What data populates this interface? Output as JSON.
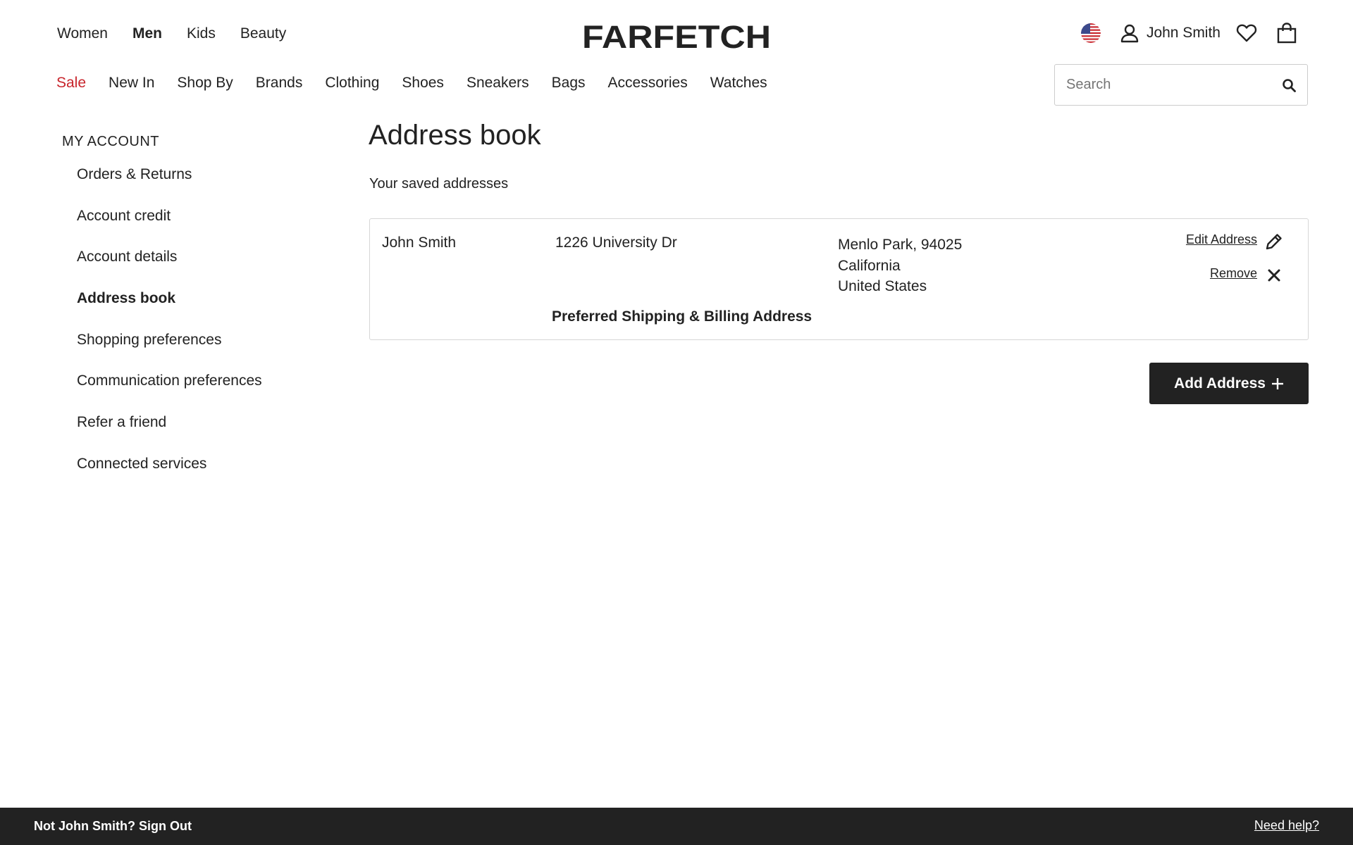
{
  "header": {
    "brand": "FARFETCH",
    "gender_tabs": [
      {
        "label": "Women",
        "active": false
      },
      {
        "label": "Men",
        "active": true
      },
      {
        "label": "Kids",
        "active": false
      },
      {
        "label": "Beauty",
        "active": false
      }
    ],
    "user_name": "John Smith",
    "icons": {
      "country_flag": "us-flag-icon",
      "user": "user-icon",
      "wishlist": "heart-icon",
      "bag": "shopping-bag-icon"
    }
  },
  "category_nav": {
    "items": [
      "Sale",
      "New In",
      "Shop By",
      "Brands",
      "Clothing",
      "Shoes",
      "Sneakers",
      "Bags",
      "Accessories",
      "Watches"
    ],
    "sale_color": "#c8252c"
  },
  "search": {
    "placeholder": "Search",
    "value": ""
  },
  "sidebar": {
    "title": "MY ACCOUNT",
    "items": [
      {
        "label": "Orders & Returns",
        "active": false
      },
      {
        "label": "Account credit",
        "active": false
      },
      {
        "label": "Account details",
        "active": false
      },
      {
        "label": "Address book",
        "active": true
      },
      {
        "label": "Shopping preferences",
        "active": false
      },
      {
        "label": "Communication preferences",
        "active": false
      },
      {
        "label": "Refer a friend",
        "active": false
      },
      {
        "label": "Connected services",
        "active": false
      }
    ]
  },
  "main": {
    "title": "Address book",
    "subtitle": "Your saved addresses",
    "address": {
      "name": "John Smith",
      "street": "1226 University Dr",
      "city_line": "Menlo Park, 94025",
      "state": "California",
      "country": "United States",
      "preferred_label": "Preferred Shipping & Billing Address",
      "edit_label": "Edit Address",
      "remove_label": "Remove"
    },
    "add_button_label": "Add Address"
  },
  "footer": {
    "signout_label": "Not John Smith? Sign Out",
    "help_label": "Need help?",
    "background": "#222222"
  }
}
